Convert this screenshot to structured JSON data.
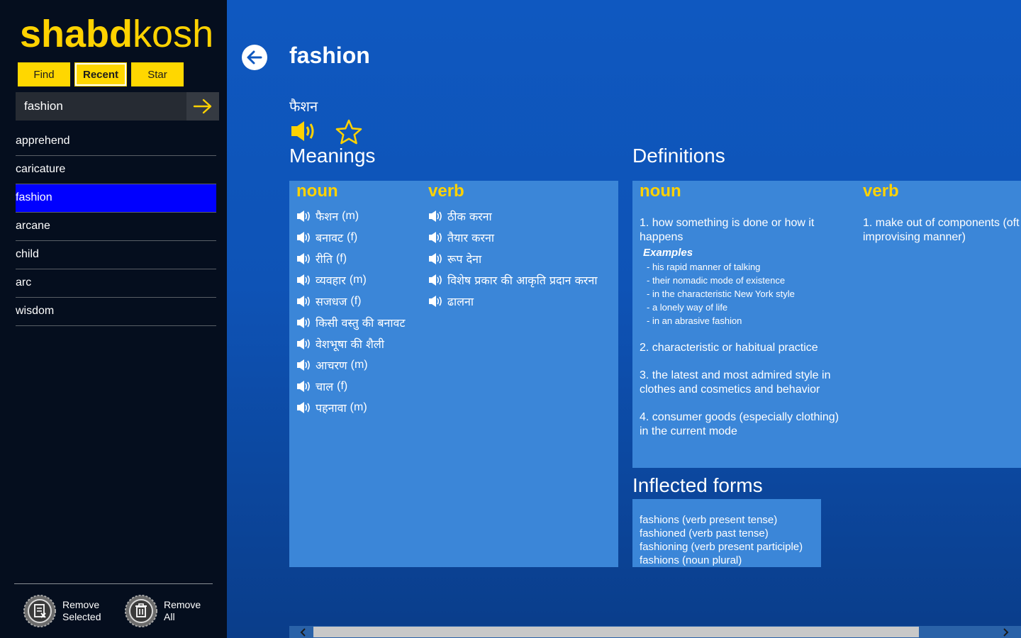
{
  "app": {
    "logo_bold": "shabd",
    "logo_light": "kosh",
    "brand_color": "#ffd200"
  },
  "sidebar": {
    "tabs": [
      {
        "label": "Find",
        "active": false
      },
      {
        "label": "Recent",
        "active": true
      },
      {
        "label": "Star",
        "active": false
      }
    ],
    "search": {
      "value": "fashion",
      "go_icon": "arrow-right-icon"
    },
    "recent": [
      {
        "label": "apprehend",
        "selected": false
      },
      {
        "label": "caricature",
        "selected": false
      },
      {
        "label": "fashion",
        "selected": true
      },
      {
        "label": "arcane",
        "selected": false
      },
      {
        "label": "child",
        "selected": false
      },
      {
        "label": "arc",
        "selected": false
      },
      {
        "label": "wisdom",
        "selected": false
      }
    ],
    "remove_selected": {
      "line1": "Remove",
      "line2": "Selected",
      "icon": "remove-selected-icon"
    },
    "remove_all": {
      "line1": "Remove",
      "line2": "All",
      "icon": "trash-icon"
    }
  },
  "word": {
    "title": "fashion",
    "hindi": "फैशन"
  },
  "meanings": {
    "heading": "Meanings",
    "noun": {
      "label": "noun",
      "items": [
        {
          "text": "फैशन",
          "gender": "(m)"
        },
        {
          "text": "बनावट",
          "gender": "(f)"
        },
        {
          "text": "रीति",
          "gender": "(f)"
        },
        {
          "text": "व्यवहार",
          "gender": "(m)"
        },
        {
          "text": "सजधज",
          "gender": "(f)"
        },
        {
          "text": "किसी वस्तु की बनावट",
          "gender": ""
        },
        {
          "text": "वेशभूषा की शैली",
          "gender": ""
        },
        {
          "text": "आचरण",
          "gender": "(m)"
        },
        {
          "text": "चाल",
          "gender": "(f)"
        },
        {
          "text": "पहनावा",
          "gender": "(m)"
        }
      ]
    },
    "verb": {
      "label": "verb",
      "items": [
        {
          "text": "ठीक करना",
          "gender": ""
        },
        {
          "text": "तैयार करना",
          "gender": ""
        },
        {
          "text": "रूप देना",
          "gender": ""
        },
        {
          "text": "विशेष प्रकार की आकृति प्रदान करना",
          "gender": ""
        },
        {
          "text": "ढालना",
          "gender": ""
        }
      ]
    }
  },
  "definitions": {
    "heading": "Definitions",
    "noun": {
      "label": "noun",
      "items": [
        {
          "text": "1. how something is done or how it happens",
          "examples_title": "Examples",
          "examples": [
            "- his rapid manner of talking",
            "- their nomadic mode of existence",
            "- in the characteristic New York style",
            "- a lonely way of life",
            "- in an abrasive fashion"
          ]
        },
        {
          "text": "2. characteristic or habitual practice",
          "examples_title": "",
          "examples": []
        },
        {
          "text": "3. the latest and most admired style in clothes and cosmetics and behavior",
          "examples_title": "",
          "examples": []
        },
        {
          "text": "4. consumer goods (especially clothing) in the current mode",
          "examples_title": "",
          "examples": []
        }
      ]
    },
    "verb": {
      "label": "verb",
      "items": [
        {
          "text": "1. make out of components (oft improvising manner)"
        }
      ]
    }
  },
  "inflected": {
    "heading": "Inflected forms",
    "items": [
      "fashions (verb present tense)",
      "fashioned (verb past tense)",
      "fashioning (verb present participle)",
      "fashions (noun plural)"
    ]
  },
  "scrollbar": {
    "left_icon": "chevron-left-icon",
    "right_icon": "chevron-right-icon"
  }
}
